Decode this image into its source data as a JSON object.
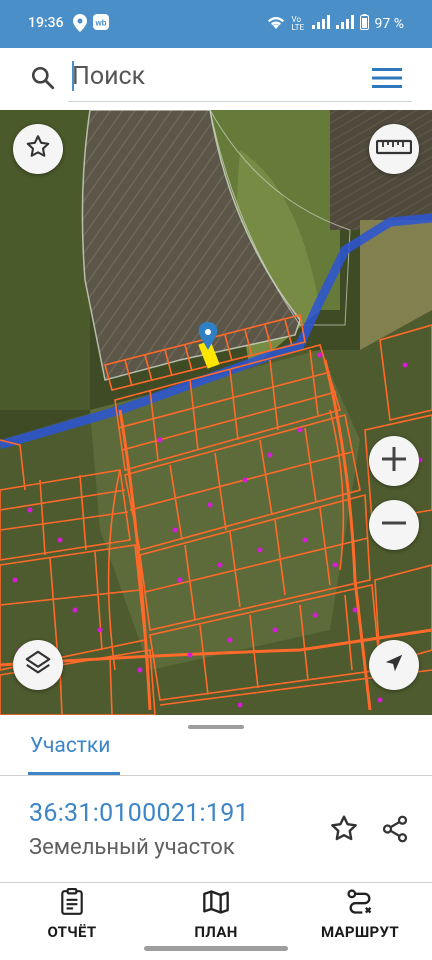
{
  "status_bar": {
    "time": "19:36",
    "network_label": "Vo\nLTE",
    "battery": "97 %"
  },
  "search": {
    "placeholder": "Поиск",
    "icon": "search-icon",
    "menu_icon": "hamburger-menu-icon"
  },
  "map": {
    "buttons": {
      "favorite": "star-outline-icon",
      "ruler": "ruler-icon",
      "zoom_in": "plus-icon",
      "zoom_out": "minus-icon",
      "layers": "layers-icon",
      "locate": "navigation-arrow-icon"
    },
    "colors": {
      "parcel_outline": "#ff6a2a",
      "selected_parcel": "#ffe600",
      "boundary_line": "#2b55d6",
      "marker": "#2f7fc4",
      "poi_dots": "#d81bd8"
    }
  },
  "sheet": {
    "tab_label": "Участки",
    "cadastral_number": "36:31:0100021:191",
    "object_type": "Земельный участок"
  },
  "bottom_nav": {
    "report": "ОТЧЁТ",
    "plan": "ПЛАН",
    "route": "МАРШРУТ"
  },
  "colors": {
    "status_bar": "#4a8fc8",
    "accent": "#3d85c6"
  }
}
